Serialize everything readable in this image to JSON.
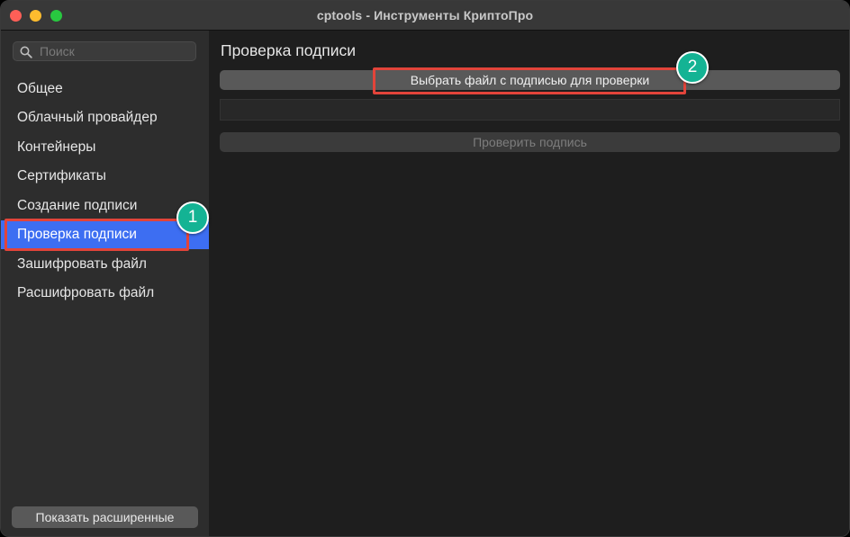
{
  "window": {
    "title": "cptools - Инструменты КриптоПро"
  },
  "sidebar": {
    "search": {
      "placeholder": "Поиск",
      "value": ""
    },
    "items": [
      {
        "label": "Общее"
      },
      {
        "label": "Облачный провайдер"
      },
      {
        "label": "Контейнеры"
      },
      {
        "label": "Сертификаты"
      },
      {
        "label": "Создание подписи"
      },
      {
        "label": "Проверка подписи",
        "selected": true
      },
      {
        "label": "Зашифровать файл"
      },
      {
        "label": "Расшифровать файл"
      }
    ],
    "show_advanced_label": "Показать расширенные"
  },
  "main": {
    "title": "Проверка подписи",
    "select_file_label": "Выбрать файл с подписью для проверки",
    "file_path_value": "",
    "verify_label": "Проверить подпись",
    "verify_enabled": false
  },
  "annotations": [
    {
      "number": "1"
    },
    {
      "number": "2"
    }
  ],
  "colors": {
    "accent": "#3d6ef2",
    "annotation_box": "#e2443a",
    "annotation_badge": "#14b394",
    "traffic_close": "#fe5f57",
    "traffic_minimize": "#febc2e",
    "traffic_zoom": "#28c840"
  },
  "icons": {
    "search": "search-icon"
  }
}
